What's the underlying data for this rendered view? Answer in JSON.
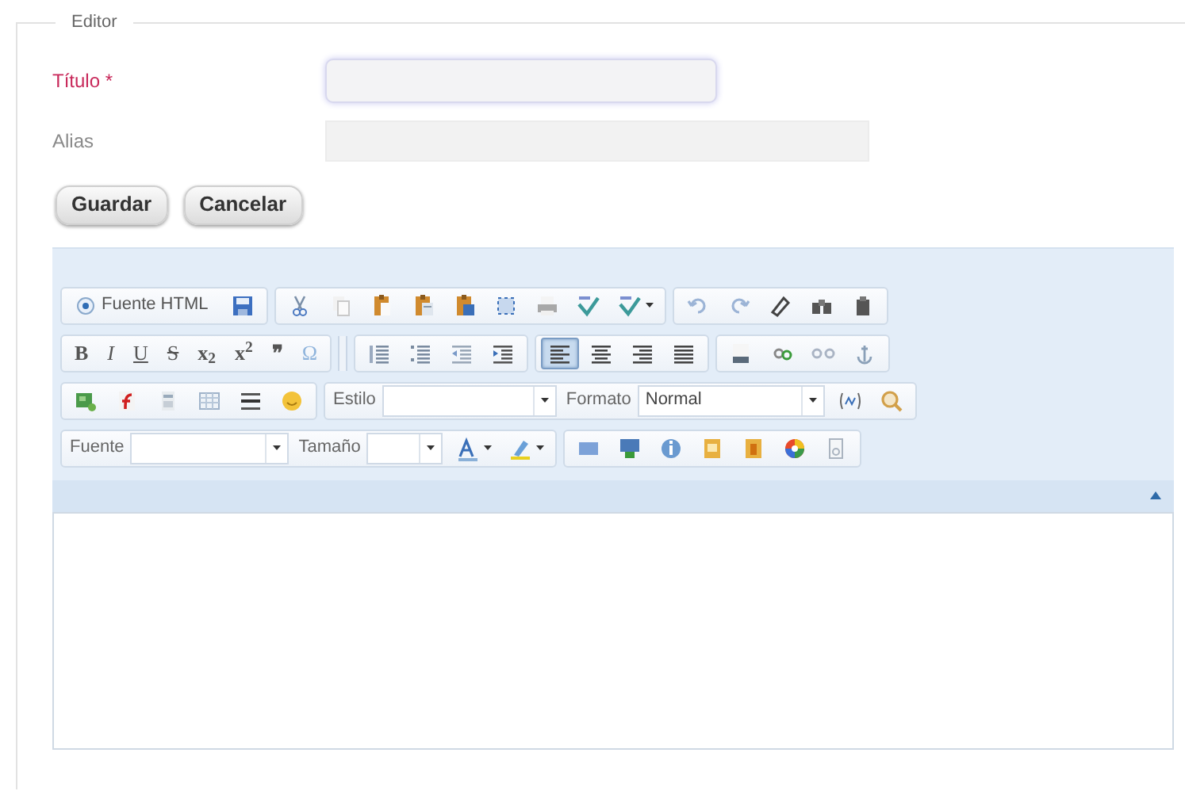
{
  "fieldset": {
    "legend": "Editor"
  },
  "fields": [
    {
      "label": "Título *",
      "required": true,
      "focused": true
    },
    {
      "label": "Alias",
      "required": false,
      "focused": false
    }
  ],
  "buttons": [
    "Guardar",
    "Cancelar"
  ],
  "toolbar": {
    "rows": [
      [
        [
          {
            "kind": "labeled",
            "text": "Fuente HTML"
          },
          {
            "kind": "icon"
          }
        ],
        [
          {
            "kind": "icon"
          },
          {
            "kind": "icon"
          },
          {
            "kind": "icon"
          },
          {
            "kind": "icon"
          },
          {
            "kind": "icon"
          },
          {
            "kind": "icon"
          },
          {
            "kind": "icon"
          },
          {
            "kind": "icon"
          },
          {
            "kind": "menu-icon"
          }
        ],
        [
          {
            "kind": "icon"
          },
          {
            "kind": "icon"
          },
          {
            "kind": "icon"
          },
          {
            "kind": "icon"
          },
          {
            "kind": "icon"
          }
        ]
      ],
      [
        [
          {
            "kind": "glyph",
            "text": "B"
          },
          {
            "kind": "glyph",
            "text": "I"
          },
          {
            "kind": "glyph",
            "text": "U"
          },
          {
            "kind": "glyph",
            "text": "S"
          },
          {
            "kind": "glyph",
            "text": "x$_{2}$"
          },
          {
            "kind": "glyph",
            "text": "x$^{2}$"
          },
          {
            "kind": "glyph",
            "text": "❞"
          },
          {
            "kind": "glyph",
            "text": "Ω"
          }
        ],
        [],
        [
          {
            "kind": "icon"
          },
          {
            "kind": "icon"
          },
          {
            "kind": "icon"
          },
          {
            "kind": "icon"
          }
        ],
        [
          {
            "kind": "icon",
            "selected": true
          },
          {
            "kind": "icon",
            "selected": false
          },
          {
            "kind": "icon",
            "selected": false
          },
          {
            "kind": "icon",
            "selected": false
          }
        ],
        [
          {
            "kind": "icon"
          },
          {
            "kind": "icon"
          },
          {
            "kind": "icon"
          },
          {
            "kind": "icon"
          }
        ]
      ],
      [
        [
          {
            "kind": "icon"
          },
          {
            "kind": "icon"
          },
          {
            "kind": "icon"
          },
          {
            "kind": "icon"
          },
          {
            "kind": "icon"
          },
          {
            "kind": "icon"
          }
        ],
        [
          {
            "kind": "combo",
            "label": "Estilo"
          },
          {
            "kind": "combo",
            "label": "Formato",
            "value": "Normal"
          },
          {
            "kind": "icon"
          },
          {
            "kind": "icon"
          }
        ]
      ],
      [
        [
          {
            "kind": "combo",
            "label": "Fuente"
          },
          {
            "kind": "combo",
            "label": "Tamaño"
          },
          {
            "kind": "menu-icon"
          },
          {
            "kind": "menu-icon"
          }
        ],
        [
          {
            "kind": "icon"
          },
          {
            "kind": "icon"
          },
          {
            "kind": "icon"
          },
          {
            "kind": "icon"
          },
          {
            "kind": "icon"
          },
          {
            "kind": "icon"
          },
          {
            "kind": "icon"
          }
        ]
      ]
    ]
  }
}
